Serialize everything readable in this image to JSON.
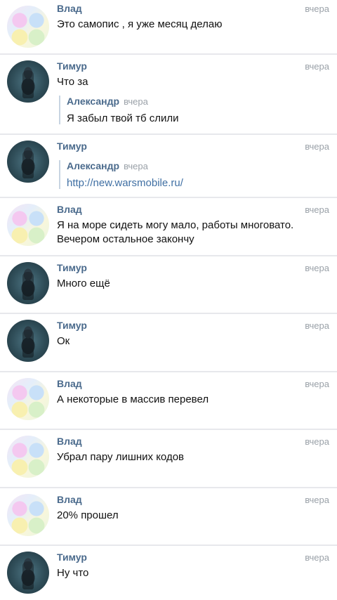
{
  "messages": [
    {
      "author": "Влад",
      "time": "вчера",
      "text": "Это самопис , я уже месяц делаю"
    },
    {
      "author": "Тимур",
      "time": "вчера",
      "text": "Что за",
      "quote": {
        "author": "Александр",
        "time": "вчера",
        "text": "Я забыл твой тб слили"
      }
    },
    {
      "author": "Тимур",
      "time": "вчера",
      "quote": {
        "author": "Александр",
        "time": "вчера",
        "link": "http://new.warsmobile.ru/"
      }
    },
    {
      "author": "Влад",
      "time": "вчера",
      "text": "Я на море сидеть могу мало, работы многовато.\nВечером остальное закончу"
    },
    {
      "author": "Тимур",
      "time": "вчера",
      "text": "Много ещё"
    },
    {
      "author": "Тимур",
      "time": "вчера",
      "text": "Ок"
    },
    {
      "author": "Влад",
      "time": "вчера",
      "text": "А некоторые в массив перевел"
    },
    {
      "author": "Влад",
      "time": "вчера",
      "text": "Убрал пару лишних кодов"
    },
    {
      "author": "Влад",
      "time": "вчера",
      "text": "20% прошел"
    },
    {
      "author": "Тимур",
      "time": "вчера",
      "text": "Ну что"
    }
  ]
}
